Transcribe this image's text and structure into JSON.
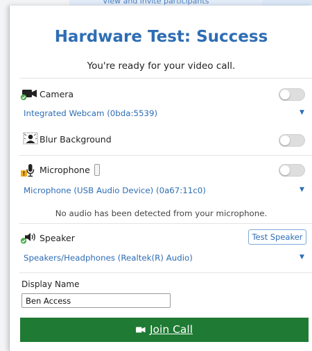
{
  "header": {
    "top_link": "View and invite participants",
    "title": "Hardware Test: Success",
    "subtitle": "You're ready for your video call."
  },
  "camera": {
    "label": "Camera",
    "device": "Integrated Webcam (0bda:5539)",
    "enabled": false,
    "status_icon": "check-badge-icon"
  },
  "blur": {
    "label": "Blur Background",
    "enabled": false
  },
  "microphone": {
    "label": "Microphone",
    "device": "Microphone (USB Audio Device) (0a67:11c0)",
    "enabled": false,
    "level": 0,
    "status_icon": "warning-badge-icon",
    "notice": "No audio has been detected from your microphone."
  },
  "speaker": {
    "label": "Speaker",
    "device": "Speakers/Headphones (Realtek(R) Audio)",
    "test_button": "Test Speaker",
    "status_icon": "check-badge-icon"
  },
  "display_name": {
    "label": "Display Name",
    "value": "Ben Access"
  },
  "join": {
    "label": "Join Call"
  },
  "colors": {
    "accent": "#2e6db4",
    "join_green": "#1f7a33",
    "success_badge": "#4cae4c",
    "warning_badge": "#f0ad1c"
  }
}
